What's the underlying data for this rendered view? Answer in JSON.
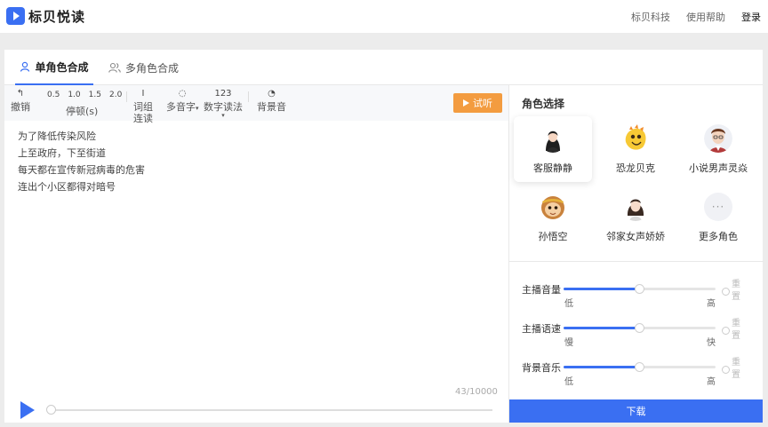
{
  "header": {
    "logo_text": "标贝悦读",
    "links": [
      "标贝科技",
      "使用帮助",
      "登录"
    ]
  },
  "tabs": [
    {
      "label": "单角色合成",
      "active": true
    },
    {
      "label": "多角色合成",
      "active": false
    }
  ],
  "toolbar": {
    "undo_label": "撤销",
    "pause_values": [
      "0.5",
      "1.0",
      "1.5",
      "2.0"
    ],
    "pause_label": "停顿(s)",
    "word_group_label": "词组连读",
    "polyphone_label": "多音字",
    "number_top": "123",
    "number_label": "数字读法",
    "bgm_label": "背景音",
    "trial_label": "试听"
  },
  "editor": {
    "lines": [
      "为了降低传染风险",
      "上至政府，下至街道",
      "每天都在宣传新冠病毒的危害",
      "连出个小区都得对暗号"
    ],
    "counter": "43/10000"
  },
  "roles": {
    "title": "角色选择",
    "items": [
      {
        "name": "客服静静",
        "selected": true
      },
      {
        "name": "恐龙贝克",
        "selected": false
      },
      {
        "name": "小说男声灵焱",
        "selected": false
      },
      {
        "name": "孙悟空",
        "selected": false
      },
      {
        "name": "邻家女声娇娇",
        "selected": false
      },
      {
        "name": "更多角色",
        "selected": false
      }
    ]
  },
  "controls": [
    {
      "label": "主播音量",
      "low": "低",
      "high": "高",
      "reset": "重置",
      "value": 0.5
    },
    {
      "label": "主播语速",
      "low": "慢",
      "high": "快",
      "reset": "重置",
      "value": 0.5
    },
    {
      "label": "背景音乐",
      "low": "低",
      "high": "高",
      "reset": "重置",
      "value": 0.5
    }
  ],
  "download_label": "下载",
  "colors": {
    "accent": "#3a6ff2",
    "trial": "#f39c40"
  }
}
